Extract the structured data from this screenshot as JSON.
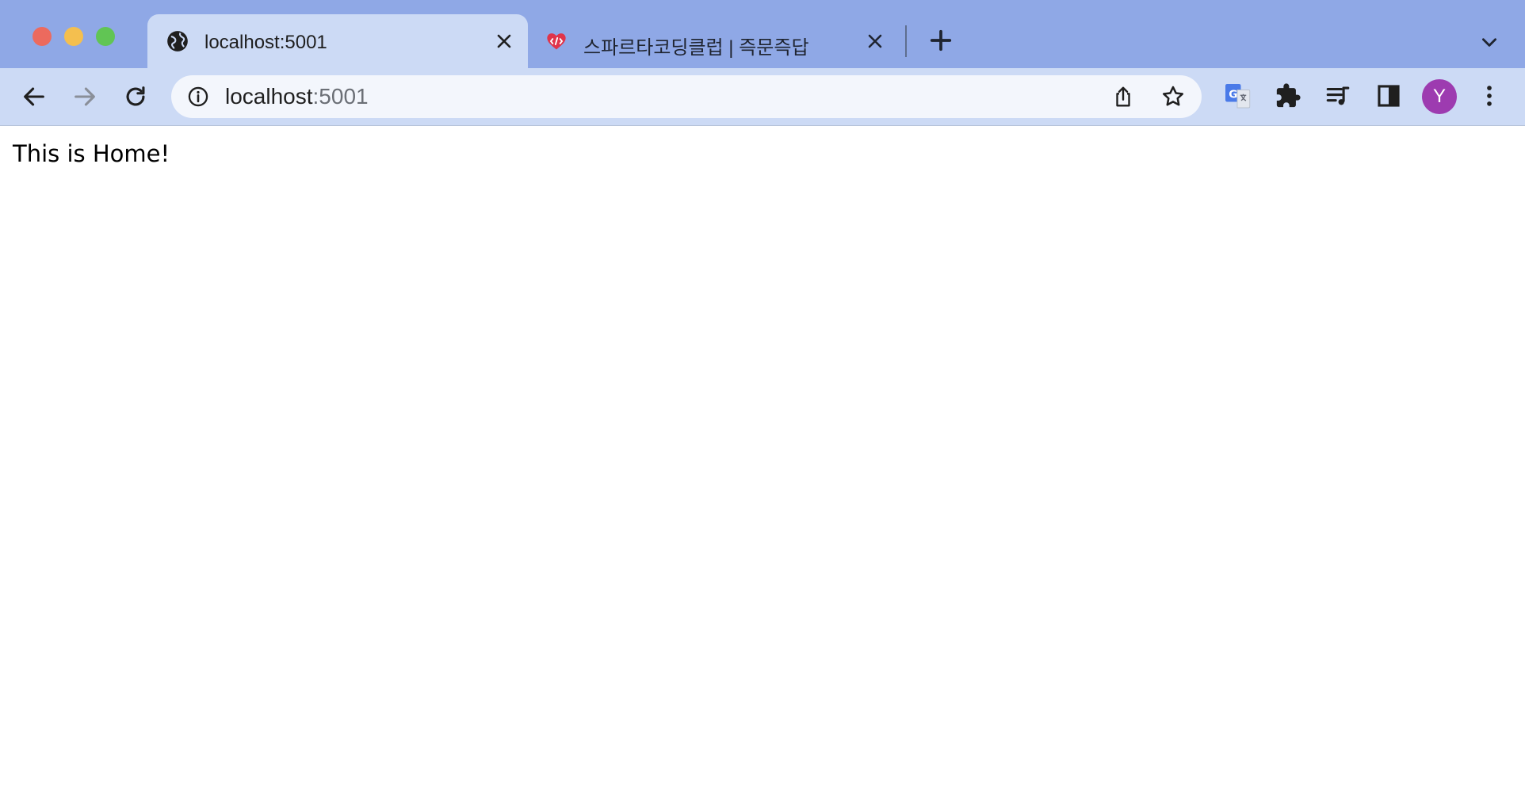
{
  "browser": {
    "tabs": [
      {
        "title": "localhost:5001",
        "favicon": "globe-icon",
        "active": true
      },
      {
        "title": "스파르타코딩클럽 | 즉문즉답",
        "favicon": "spartacoding-logo-icon",
        "active": false
      }
    ],
    "address": {
      "host": "localhost",
      "port": ":5001"
    },
    "profile": {
      "initial": "Y",
      "color": "#9d3bb0"
    }
  },
  "page": {
    "text": "This is Home!"
  },
  "colors": {
    "tabstrip": "#8fa8e6",
    "toolbar": "#ccdaf5",
    "omnibox": "#f3f6fc",
    "favicon_red": "#e0344a"
  }
}
